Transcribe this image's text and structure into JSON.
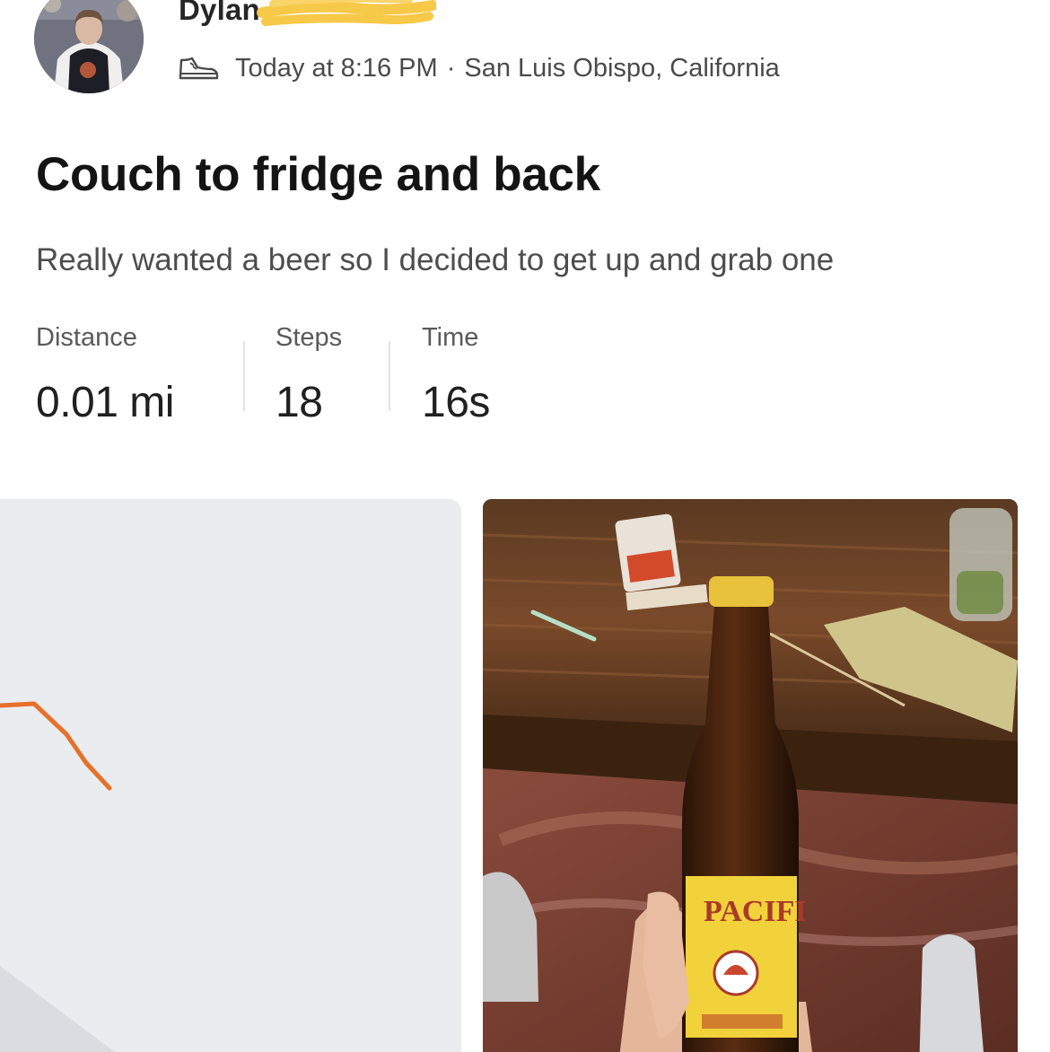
{
  "post": {
    "user_name": "Dylan",
    "timestamp": "Today at 8:16 PM",
    "separator": "·",
    "location": "San Luis Obispo, California",
    "activity_type_icon": "shoe-icon"
  },
  "activity": {
    "title": "Couch to fridge and back",
    "description": "Really wanted a beer so I decided to get up and grab one"
  },
  "stats": [
    {
      "label": "Distance",
      "value": "0.01 mi"
    },
    {
      "label": "Steps",
      "value": "18"
    },
    {
      "label": "Time",
      "value": "16s"
    }
  ],
  "colors": {
    "route_line": "#e8702a",
    "redaction": "#f7c948",
    "map_background": "#eaedf0"
  }
}
